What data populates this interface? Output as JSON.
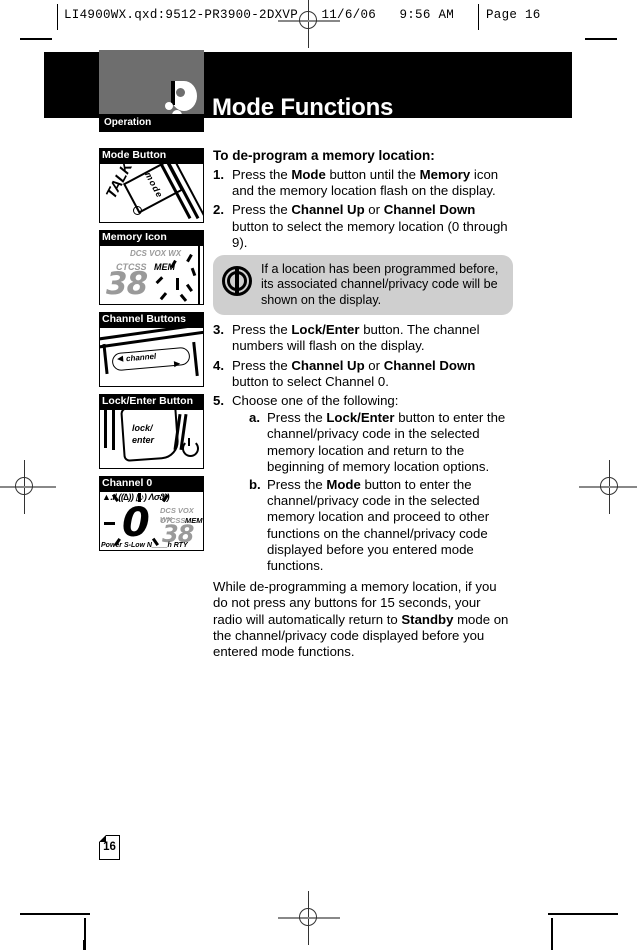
{
  "slug": {
    "left_text": "LI4900WX.qxd:9512-PR3900-2DXVP   11/6/06   9:56 AM",
    "right_text": "Page 16"
  },
  "banner": {
    "title": "Mode Functions",
    "tab_label": "Operation",
    "logo_name": "swoosh-logo"
  },
  "figures": [
    {
      "caption": "Mode Button",
      "art": {
        "button_label": "mode",
        "side_label": "TALK"
      }
    },
    {
      "caption": "Memory Icon",
      "art": {
        "row1": "DCS VOX WX",
        "row2_left": "CTCSS",
        "row2_right": "MEM",
        "digits": "38"
      }
    },
    {
      "caption": "Channel Buttons",
      "art": {
        "button_label": "channel",
        "left_arrow": "◀",
        "right_arrow": "▶"
      }
    },
    {
      "caption": "Lock/Enter Button",
      "art": {
        "line1": "lock/",
        "line2": "enter",
        "power_icon": "power-icon"
      }
    },
    {
      "caption": "Channel 0",
      "art": {
        "big_digit": "0",
        "row1": "DCS VOX WX",
        "row2_left": "CTCSS",
        "row2_right": "MEM",
        "digits": "38"
      }
    }
  ],
  "content": {
    "heading": "To de-program a memory location:",
    "steps": [
      {
        "num": "1.",
        "parts": [
          {
            "t": "Press the ",
            "b": false
          },
          {
            "t": "Mode",
            "b": true
          },
          {
            "t": " button until the ",
            "b": false
          },
          {
            "t": "Memory",
            "b": true
          },
          {
            "t": " icon and the memory location flash on the display.",
            "b": false
          }
        ]
      },
      {
        "num": "2.",
        "parts": [
          {
            "t": "Press the ",
            "b": false
          },
          {
            "t": "Channel Up",
            "b": true
          },
          {
            "t": " or ",
            "b": false
          },
          {
            "t": "Channel Down",
            "b": true
          },
          {
            "t": " button to select the memory location (0 through 9).",
            "b": false
          }
        ]
      }
    ],
    "note": {
      "icon": "note-power-icon",
      "text": "If a location has been programmed before, its associated channel/privacy code will be shown on the display."
    },
    "steps2": [
      {
        "num": "3.",
        "parts": [
          {
            "t": "Press the ",
            "b": false
          },
          {
            "t": "Lock/Enter",
            "b": true
          },
          {
            "t": " button. The channel numbers will flash on the display.",
            "b": false
          }
        ]
      },
      {
        "num": "4.",
        "parts": [
          {
            "t": "Press the ",
            "b": false
          },
          {
            "t": "Channel Up",
            "b": true
          },
          {
            "t": " or ",
            "b": false
          },
          {
            "t": "Channel Down",
            "b": true
          },
          {
            "t": " button to select Channel 0.",
            "b": false
          }
        ]
      },
      {
        "num": "5.",
        "parts": [
          {
            "t": "Choose one of the following:",
            "b": false
          }
        ],
        "sub": [
          {
            "num": "a.",
            "parts": [
              {
                "t": "Press the ",
                "b": false
              },
              {
                "t": "Lock/Enter",
                "b": true
              },
              {
                "t": " button to enter the channel/privacy code in the selected memory location and return to the beginning of memory location options.",
                "b": false
              }
            ]
          },
          {
            "num": "b.",
            "parts": [
              {
                "t": "Press the ",
                "b": false
              },
              {
                "t": "Mode",
                "b": true
              },
              {
                "t": " button to enter the channel/privacy code in the selected memory location and proceed to other functions on the channel/privacy code displayed before you entered mode functions.",
                "b": false
              }
            ]
          }
        ]
      }
    ],
    "outro": [
      {
        "t": "While de-programming a memory location, if you do not press any buttons for 15 seconds, your radio will automatically return to ",
        "b": false
      },
      {
        "t": "Standby",
        "b": true
      },
      {
        "t": " mode on the channel/privacy code displayed before you entered mode functions.",
        "b": false
      }
    ]
  },
  "page_number": "16",
  "colors": {
    "banner_bg": "#000000",
    "gray_block": "#6e6e6e",
    "note_bg": "#cfcfcf",
    "lcd_gray": "#9a9a9a"
  }
}
